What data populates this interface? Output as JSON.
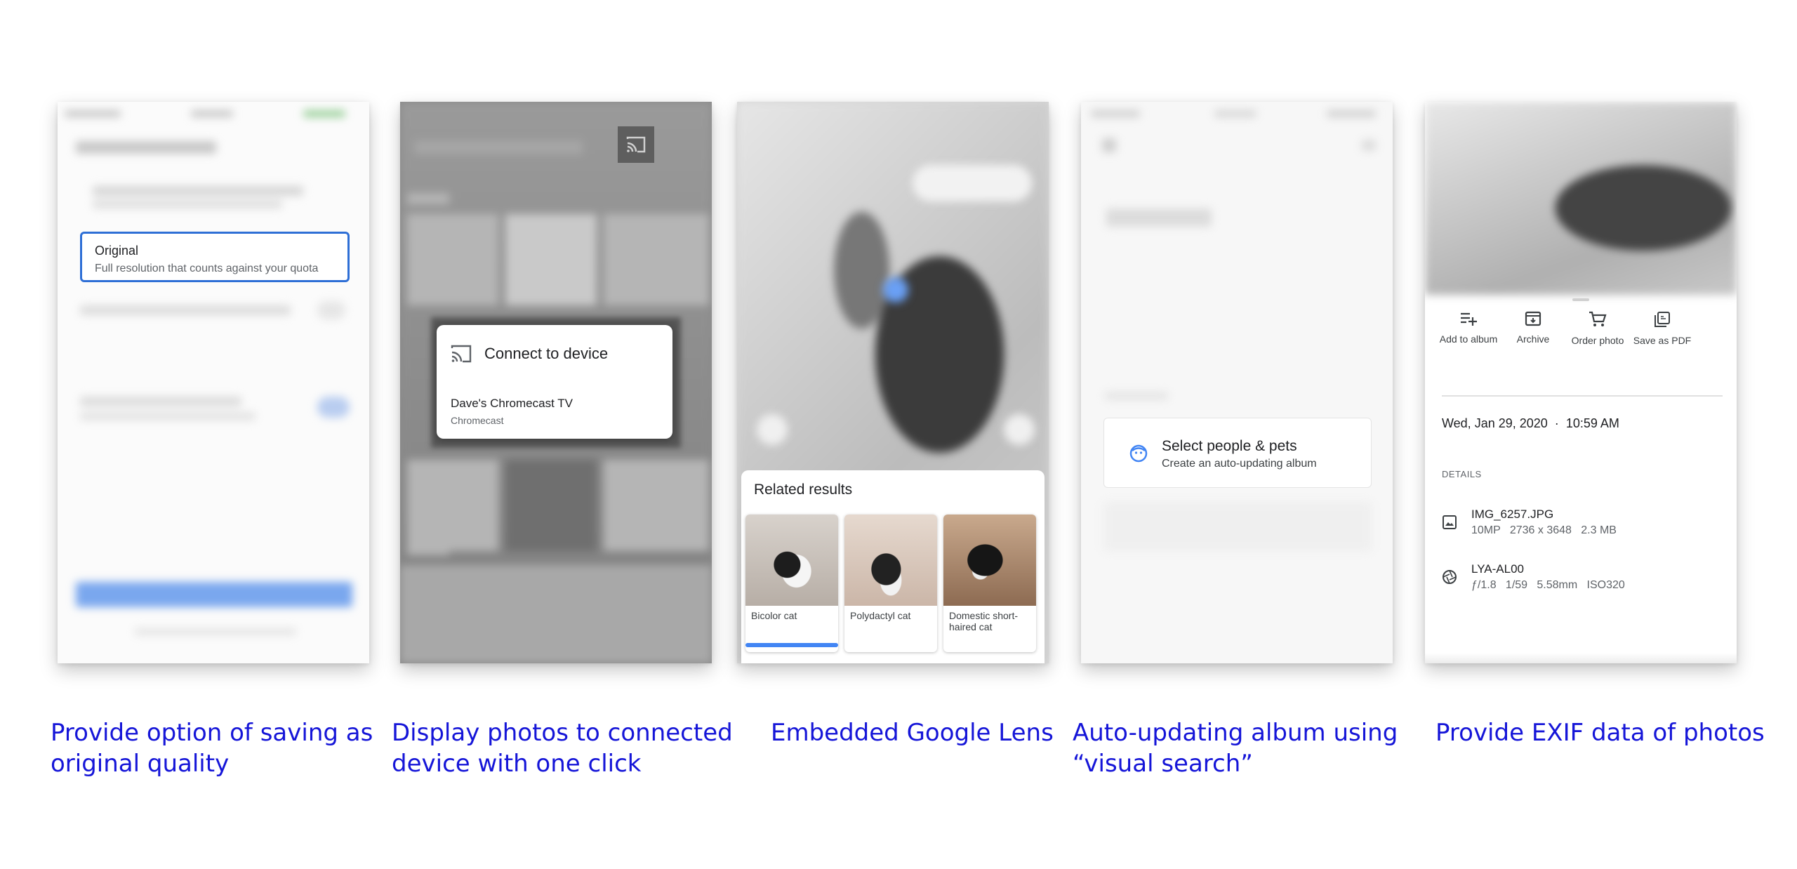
{
  "panels": [
    {
      "caption_line1": "Provide option of saving as",
      "caption_line2": "original quality",
      "card_title": "Original",
      "card_subtitle": "Full resolution that counts against your quota"
    },
    {
      "caption_line1": "Display photos to connected",
      "caption_line2": "device with one click",
      "dialog_title": "Connect to device",
      "device_name": "Dave's Chromecast TV",
      "device_type": "Chromecast"
    },
    {
      "caption_line1": "Embedded Google Lens",
      "related_title": "Related results",
      "results": [
        {
          "label": "Bicolor cat"
        },
        {
          "label": "Polydactyl cat"
        },
        {
          "label": "Domestic short-haired cat"
        }
      ]
    },
    {
      "caption_line1": "Auto-updating album using",
      "caption_line2": "“visual search”",
      "option_title": "Select people & pets",
      "option_subtitle": "Create an auto-updating album"
    },
    {
      "caption_line1": "Provide EXIF data of photos",
      "actions": [
        {
          "label": "Add to album",
          "icon": "add-to-album-icon"
        },
        {
          "label": "Archive",
          "icon": "archive-icon"
        },
        {
          "label": "Order photo",
          "icon": "cart-icon"
        },
        {
          "label": "Save as PDF",
          "icon": "pdf-icon"
        }
      ],
      "date": "Wed, Jan 29, 2020",
      "time": "10:59 AM",
      "details_heading": "DETAILS",
      "file_name": "IMG_6257.JPG",
      "file_info": "10MP   2736 x 3648   2.3 MB",
      "camera_model": "LYA-AL00",
      "camera_info": "ƒ/1.8   1/59   5.58mm   ISO320"
    }
  ],
  "colors": {
    "caption": "#1515d8",
    "accent": "#2e6fd6",
    "progress": "#4285f4"
  }
}
